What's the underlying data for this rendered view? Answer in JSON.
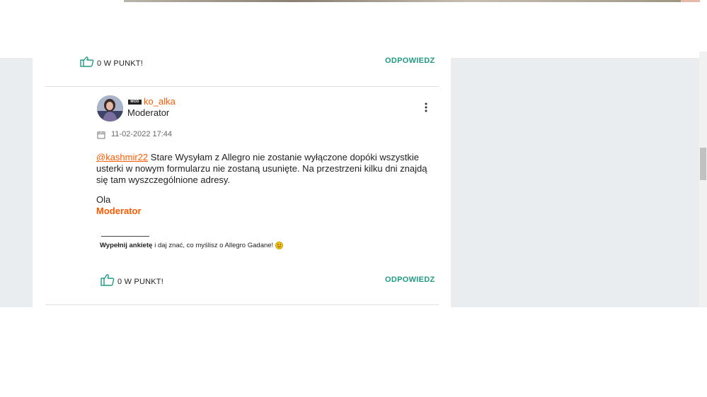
{
  "colors": {
    "accent_orange": "#ff5a00",
    "reply_green": "#1f9a84",
    "band_gray": "#eaedf0"
  },
  "previous_post": {
    "like_label": "0 W PUNKT!",
    "reply_label": "ODPOWIEDZ",
    "like_icon": "thumbs-up-icon"
  },
  "post": {
    "badge": "MOD",
    "username": "ko_alka",
    "role": "Moderator",
    "date": "11-02-2022 17:44",
    "date_icon": "calendar-icon",
    "mention": "@kashmir22",
    "body": " Stare Wysyłam z Allegro nie zostanie wyłączone dopóki wszystkie usterki w nowym formularzu nie zostaną usunięte. Na przestrzeni kilku dni znajdą się tam wyszczególnione adresy.",
    "signature_name": "Ola",
    "signature_role": "Moderator",
    "survey_link": "Wypełnij ankietę",
    "survey_text": "i daj znać, co myślisz o Allegro Gadane!",
    "survey_icon": "smile-emoji-icon",
    "menu_icon": "more-vertical-icon",
    "like_label": "0 W PUNKT!",
    "reply_label": "ODPOWIEDZ"
  }
}
